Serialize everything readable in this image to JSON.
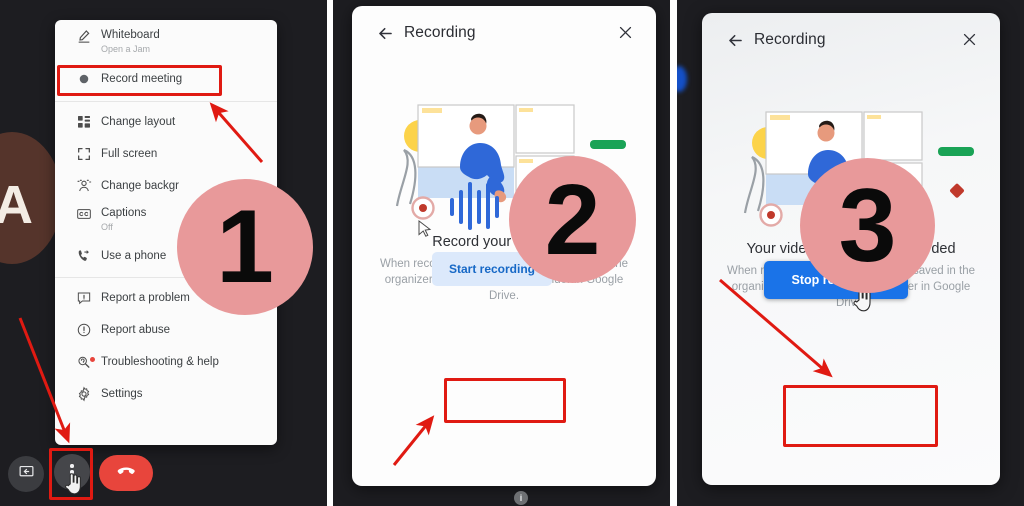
{
  "theme": {
    "accent_blue": "#1a73e8",
    "light_blue_btn": "#dce9fb",
    "annotation_red": "#e01a12",
    "badge_pink": "#e8999a",
    "meet_dark": "#1d1d21",
    "hangup_red": "#e8453c"
  },
  "panel1": {
    "name": "google-meet-more-options-menu",
    "avatar_letter": "A",
    "menu": {
      "items": [
        {
          "id": "whiteboard",
          "icon": "pencil-icon",
          "label": "Whiteboard",
          "sublabel": "Open a Jam",
          "highlighted": false
        },
        {
          "id": "record",
          "icon": "record-dot-icon",
          "label": "Record meeting",
          "sublabel": "",
          "highlighted": true
        },
        {
          "id": "layout",
          "icon": "grid-layout-icon",
          "label": "Change layout",
          "sublabel": "",
          "highlighted": false
        },
        {
          "id": "fullscreen",
          "icon": "fullscreen-icon",
          "label": "Full screen",
          "sublabel": "",
          "highlighted": false
        },
        {
          "id": "background",
          "icon": "person-blur-icon",
          "label": "Change backgr",
          "sublabel": "",
          "highlighted": false
        },
        {
          "id": "captions",
          "icon": "closed-caption-icon",
          "label": "Captions",
          "sublabel": "Off",
          "highlighted": false
        },
        {
          "id": "phone",
          "icon": "phone-forward-icon",
          "label": "Use a phone",
          "sublabel": "",
          "highlighted": false
        },
        {
          "id": "report",
          "icon": "report-problem-icon",
          "label": "Report a problem",
          "sublabel": "",
          "highlighted": false
        },
        {
          "id": "abuse",
          "icon": "report-abuse-icon",
          "label": "Report abuse",
          "sublabel": "",
          "highlighted": false
        },
        {
          "id": "troubleshoot",
          "icon": "troubleshooting-icon",
          "label": "Troubleshooting & help",
          "sublabel": "",
          "highlighted": false
        },
        {
          "id": "settings",
          "icon": "gear-icon",
          "label": "Settings",
          "sublabel": "",
          "highlighted": false
        }
      ]
    },
    "controls": [
      {
        "id": "present",
        "icon": "present-screen-icon"
      },
      {
        "id": "more",
        "icon": "three-dots-icon"
      },
      {
        "id": "hangup",
        "icon": "hangup-phone-icon"
      }
    ],
    "badge": "1"
  },
  "panel2": {
    "name": "recording-start-dialog",
    "back_icon": "back-arrow-icon",
    "close_icon": "close-icon",
    "title": "Recording",
    "illustration": "video-call-recording-illustration",
    "heading": "Record your video call",
    "body": "When recording is finished, it will be saved in the organizer's \"Meet Recordings\" folder in Google Drive.",
    "button_label": "Start recording",
    "info_icon": "info-icon",
    "badge": "2"
  },
  "panel3": {
    "name": "recording-active-dialog",
    "back_icon": "back-arrow-icon",
    "close_icon": "close-icon",
    "title": "Recording",
    "illustration": "video-call-recording-illustration",
    "heading": "Your video call is being recorded",
    "body": "When recording is finished, it will be saved in the organizer's \"Meet Recordings\" folder in Google Drive.",
    "button_label": "Stop recording",
    "badge": "3"
  }
}
